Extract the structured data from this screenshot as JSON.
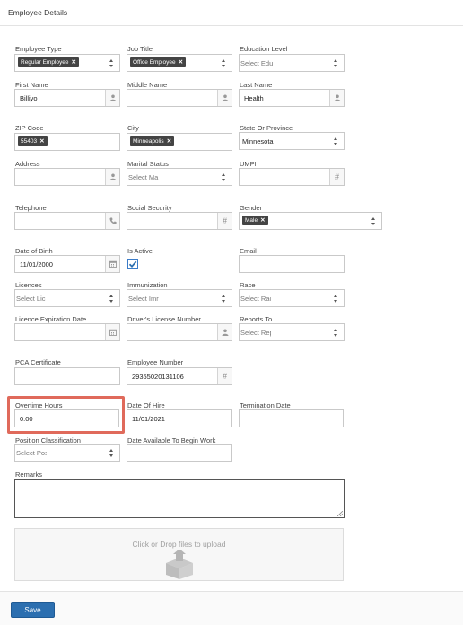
{
  "header": {
    "title": "Employee Details"
  },
  "fields": {
    "employee_type": {
      "label": "Employee Type",
      "tag": "Regular Employee"
    },
    "job_title": {
      "label": "Job Title",
      "tag": "Office Employee"
    },
    "education_level": {
      "label": "Education Level",
      "placeholder": "Select Edu"
    },
    "first_name": {
      "label": "First Name",
      "value": "Billiyo"
    },
    "middle_name": {
      "label": "Middle Name",
      "value": ""
    },
    "last_name": {
      "label": "Last Name",
      "value": "Health"
    },
    "zip_code": {
      "label": "ZIP Code",
      "tag": "55403"
    },
    "city": {
      "label": "City",
      "tag": "Minneapolis"
    },
    "state": {
      "label": "State Or Province",
      "value": "Minnesota"
    },
    "address": {
      "label": "Address",
      "value": ""
    },
    "marital_status": {
      "label": "Marital Status",
      "placeholder": "Select Ma"
    },
    "umpi": {
      "label": "UMPI",
      "value": ""
    },
    "telephone": {
      "label": "Telephone",
      "value": ""
    },
    "social_security": {
      "label": "Social Security",
      "value": ""
    },
    "gender": {
      "label": "Gender",
      "tag": "Male"
    },
    "date_of_birth": {
      "label": "Date of Birth",
      "value": "11/01/2000"
    },
    "is_active": {
      "label": "Is Active",
      "checked": true
    },
    "email": {
      "label": "Email",
      "value": ""
    },
    "licences": {
      "label": "Licences",
      "placeholder": "Select Lic"
    },
    "immunization": {
      "label": "Immunization",
      "placeholder": "Select Imr"
    },
    "race": {
      "label": "Race",
      "placeholder": "Select Rac"
    },
    "licence_expiration": {
      "label": "Licence Expiration Date",
      "value": ""
    },
    "drivers_license": {
      "label": "Driver's License Number",
      "value": ""
    },
    "reports_to": {
      "label": "Reports To",
      "placeholder": "Select Rep"
    },
    "pca_certificate": {
      "label": "PCA Certificate",
      "value": ""
    },
    "employee_number": {
      "label": "Employee Number",
      "value": "29355020131106"
    },
    "overtime_hours": {
      "label": "Overtime Hours",
      "value": "0.00"
    },
    "date_of_hire": {
      "label": "Date Of Hire",
      "value": "11/01/2021"
    },
    "termination_date": {
      "label": "Termination Date",
      "value": ""
    },
    "position_classification": {
      "label": "Position Classification",
      "placeholder": "Select Pos"
    },
    "date_available": {
      "label": "Date Available To Begin Work",
      "value": ""
    },
    "remarks": {
      "label": "Remarks",
      "value": ""
    }
  },
  "upload": {
    "text": "Click or Drop files to upload",
    "icon": "upload-box-icon"
  },
  "footer": {
    "save_label": "Save"
  },
  "colors": {
    "accent": "#2c6fb0",
    "highlight": "#e06a5b",
    "tag_bg": "#444444"
  }
}
